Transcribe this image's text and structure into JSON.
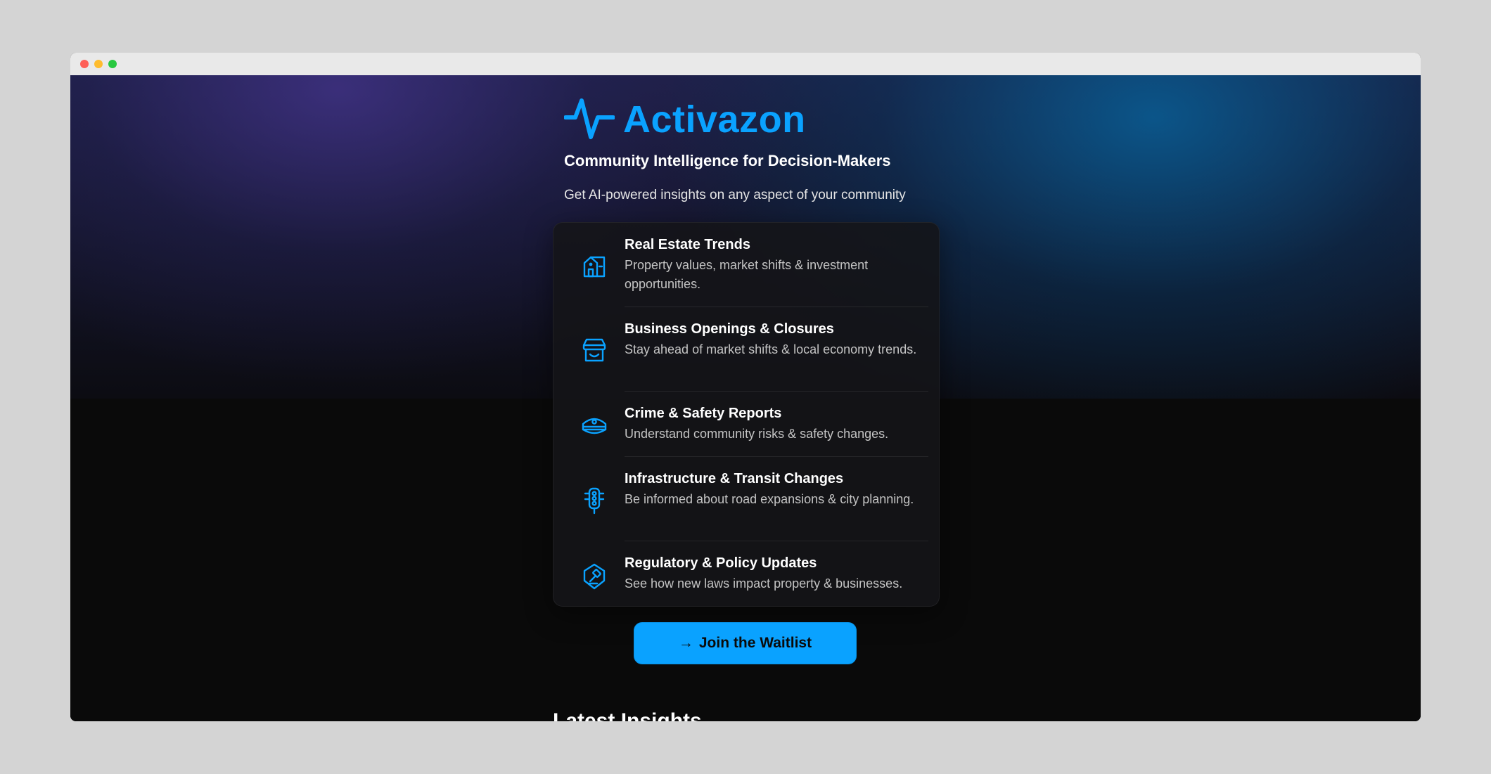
{
  "brand": {
    "name": "Activazon",
    "logo_icon": "pulse-icon",
    "accent_color": "#0aa2ff"
  },
  "hero": {
    "tagline": "Community Intelligence for Decision-Makers",
    "subtitle": "Get AI-powered insights on any aspect of your community"
  },
  "features": [
    {
      "icon": "house-icon",
      "title": "Real Estate Trends",
      "description": "Property values, market shifts & investment opportunities."
    },
    {
      "icon": "storefront-icon",
      "title": "Business Openings & Closures",
      "description": "Stay ahead of market shifts & local economy trends."
    },
    {
      "icon": "police-cap-icon",
      "title": "Crime & Safety Reports",
      "description": "Understand community risks & safety changes."
    },
    {
      "icon": "traffic-light-icon",
      "title": "Infrastructure & Transit Changes",
      "description": "Be informed about road expansions & city planning."
    },
    {
      "icon": "gavel-shield-icon",
      "title": "Regulatory & Policy Updates",
      "description": "See how new laws impact property & businesses."
    }
  ],
  "cta": {
    "arrow": "→",
    "label": "Join the Waitlist"
  },
  "latest": {
    "heading": "Latest Insights"
  }
}
